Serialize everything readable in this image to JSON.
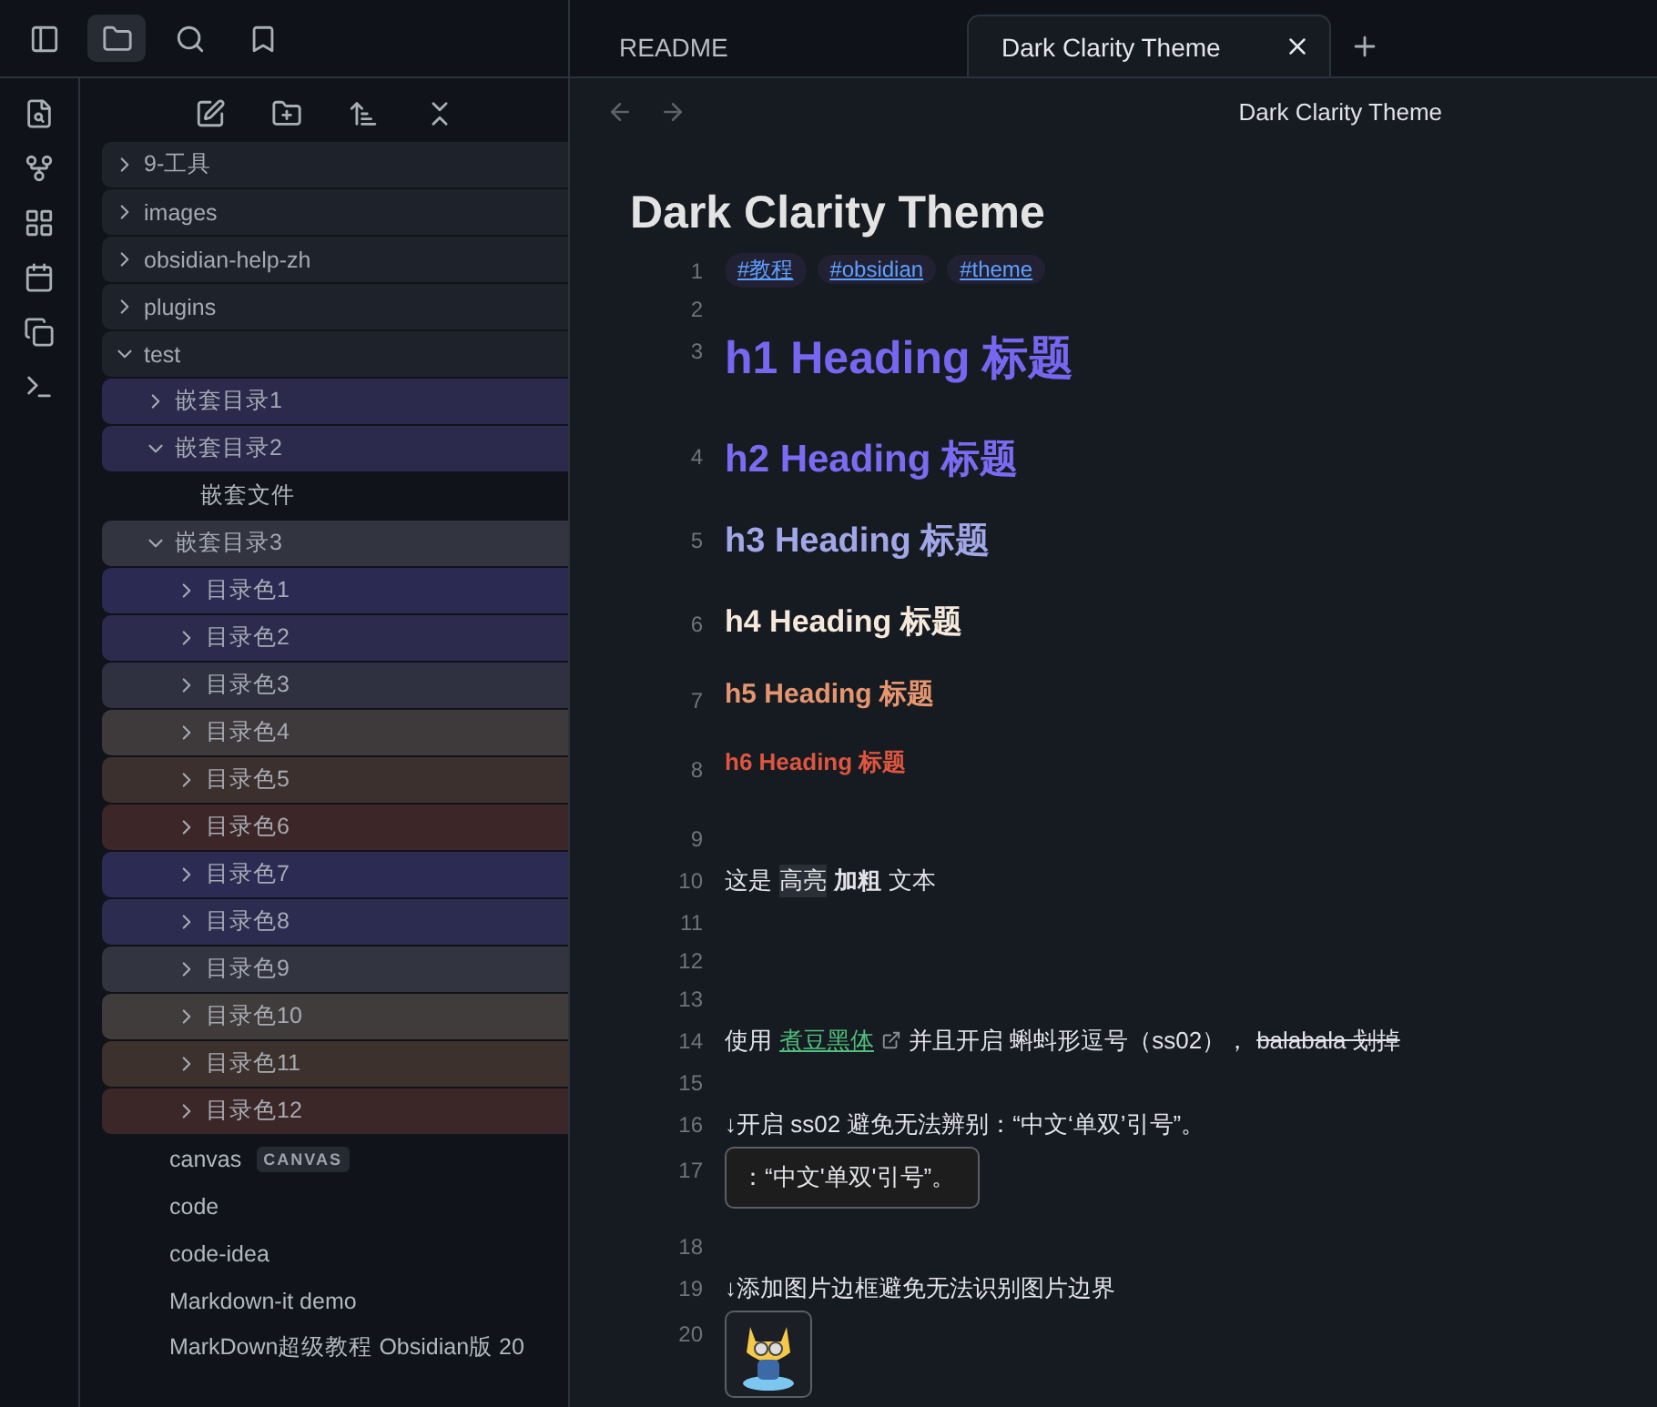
{
  "sidebar_tabs": [
    {
      "selected": true
    },
    {
      "selected": false
    },
    {
      "selected": false
    }
  ],
  "tabs": [
    {
      "label": "README",
      "selected": false
    },
    {
      "label": "Dark Clarity Theme",
      "selected": true
    }
  ],
  "file_tree": [
    {
      "kind": "folder",
      "name": "9-工具",
      "expanded": false
    },
    {
      "kind": "folder",
      "name": "images",
      "expanded": false
    },
    {
      "kind": "folder",
      "name": "obsidian-help-zh",
      "expanded": false
    },
    {
      "kind": "folder",
      "name": "plugins",
      "expanded": false
    },
    {
      "kind": "folder",
      "name": "test",
      "expanded": true,
      "children": [
        {
          "kind": "folder",
          "name": "嵌套目录1",
          "expanded": false,
          "color": "#2b2a4c"
        },
        {
          "kind": "folder",
          "name": "嵌套目录2",
          "expanded": true,
          "color": "#2b2a4c",
          "children": [
            {
              "kind": "file",
              "name": "嵌套文件"
            }
          ]
        },
        {
          "kind": "folder",
          "name": "嵌套目录3",
          "expanded": true,
          "color": "#32343f",
          "children": [
            {
              "kind": "folder",
              "name": "目录色1",
              "expanded": false,
              "color": "#2a2a52"
            },
            {
              "kind": "folder",
              "name": "目录色2",
              "expanded": false,
              "color": "#2c2b4e"
            },
            {
              "kind": "folder",
              "name": "目录色3",
              "expanded": false,
              "color": "#2f3140"
            },
            {
              "kind": "folder",
              "name": "目录色4",
              "expanded": false,
              "color": "#3e3a3b"
            },
            {
              "kind": "folder",
              "name": "目录色5",
              "expanded": false,
              "color": "#3b302d"
            },
            {
              "kind": "folder",
              "name": "目录色6",
              "expanded": false,
              "color": "#3d2627"
            },
            {
              "kind": "folder",
              "name": "目录色7",
              "expanded": false,
              "color": "#2c2b54"
            },
            {
              "kind": "folder",
              "name": "目录色8",
              "expanded": false,
              "color": "#2b2c50"
            },
            {
              "kind": "folder",
              "name": "目录色9",
              "expanded": false,
              "color": "#323440"
            },
            {
              "kind": "folder",
              "name": "目录色10",
              "expanded": false,
              "color": "#403c3c"
            },
            {
              "kind": "folder",
              "name": "目录色11",
              "expanded": false,
              "color": "#3c312d"
            },
            {
              "kind": "folder",
              "name": "目录色12",
              "expanded": false,
              "color": "#3c2728"
            }
          ]
        },
        {
          "kind": "file",
          "name": "canvas",
          "badge": "CANVAS"
        },
        {
          "kind": "file",
          "name": "code"
        },
        {
          "kind": "file",
          "name": "code-idea"
        },
        {
          "kind": "file",
          "name": "Markdown-it demo"
        },
        {
          "kind": "file",
          "name": "MarkDown超级教程 Obsidian版 20"
        }
      ]
    }
  ],
  "editor": {
    "header_title": "Dark Clarity Theme",
    "inline_title": "Dark Clarity Theme",
    "lines": [
      {
        "number": "1",
        "kind": "tags",
        "tags": [
          "#教程",
          "#obsidian",
          "#theme"
        ]
      },
      {
        "number": "2",
        "kind": "blank"
      },
      {
        "number": "3",
        "kind": "h1",
        "text": "h1 Heading 标题"
      },
      {
        "number": "4",
        "kind": "h2",
        "text": "h2 Heading 标题"
      },
      {
        "number": "5",
        "kind": "h3",
        "text": "h3 Heading 标题"
      },
      {
        "number": "6",
        "kind": "h4",
        "text": "h4 Heading 标题"
      },
      {
        "number": "7",
        "kind": "h5",
        "text": "h5 Heading 标题"
      },
      {
        "number": "8",
        "kind": "h6",
        "text": "h6 Heading 标题"
      },
      {
        "number": "9",
        "kind": "blank"
      },
      {
        "number": "10",
        "kind": "paragraph",
        "segments": [
          {
            "kind": "plain",
            "text": "这是"
          },
          {
            "kind": "mark",
            "text": "高亮"
          },
          {
            "kind": "bold",
            "text": "加粗"
          },
          {
            "kind": "plain",
            "text": "文本"
          }
        ]
      },
      {
        "number": "11",
        "kind": "blank"
      },
      {
        "number": "12",
        "kind": "blank"
      },
      {
        "number": "13",
        "kind": "blank"
      },
      {
        "number": "14",
        "kind": "paragraph",
        "segments": [
          {
            "kind": "plain",
            "text": "使用"
          },
          {
            "kind": "link",
            "text": "煮豆黑体"
          },
          {
            "kind": "plain",
            "text": "并且开启 蝌蚪形逗号（ss02），"
          },
          {
            "kind": "strike",
            "text": "balabala 划掉"
          }
        ]
      },
      {
        "number": "15",
        "kind": "blank"
      },
      {
        "number": "16",
        "kind": "paragraph",
        "segments": [
          {
            "kind": "plain",
            "text": "↓开启 ss02 避免无法辨别：“中文‘单双’引号”。"
          }
        ]
      },
      {
        "number": "17",
        "kind": "code",
        "text": "：“中文'单双'引号”。"
      },
      {
        "number": "18",
        "kind": "blank"
      },
      {
        "number": "19",
        "kind": "paragraph",
        "segments": [
          {
            "kind": "plain",
            "text": "↓添加图片边框避免无法识别图片边界"
          }
        ]
      },
      {
        "number": "20",
        "kind": "image"
      }
    ]
  }
}
